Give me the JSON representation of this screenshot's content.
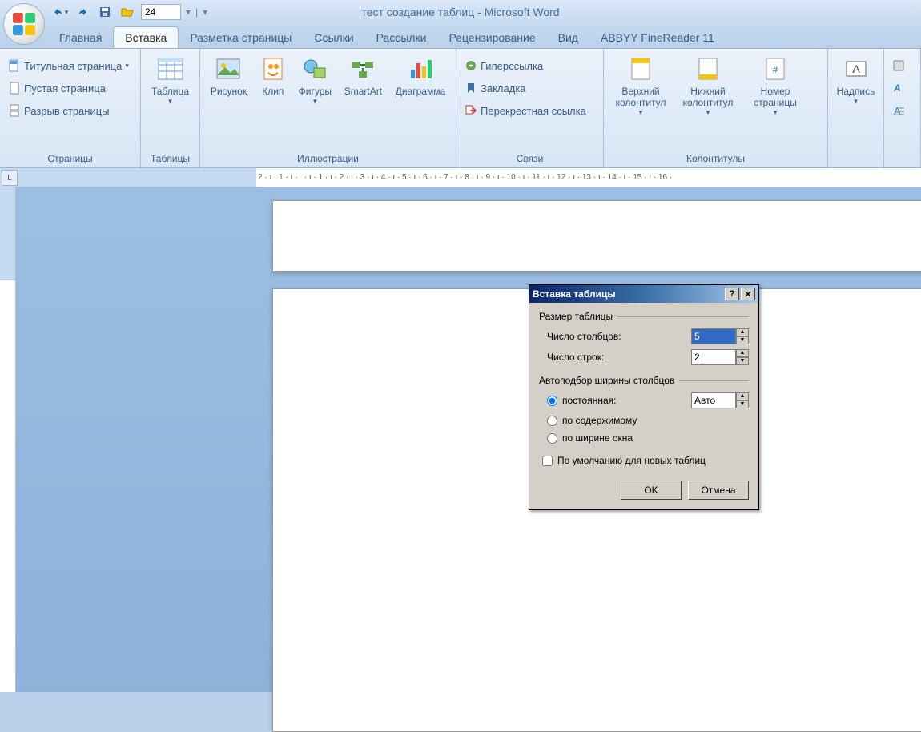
{
  "window": {
    "title": "тест создание таблиц - Microsoft Word"
  },
  "qat": {
    "font_size": "24"
  },
  "tabs": {
    "home": "Главная",
    "insert": "Вставка",
    "layout": "Разметка страницы",
    "refs": "Ссылки",
    "mail": "Рассылки",
    "review": "Рецензирование",
    "view": "Вид",
    "abbyy": "ABBYY FineReader 11"
  },
  "ribbon": {
    "pages": {
      "label": "Страницы",
      "cover": "Титульная страница",
      "blank": "Пустая страница",
      "break": "Разрыв страницы"
    },
    "tables": {
      "label": "Таблицы",
      "table": "Таблица"
    },
    "illus": {
      "label": "Иллюстрации",
      "picture": "Рисунок",
      "clip": "Клип",
      "shapes": "Фигуры",
      "smartart": "SmartArt",
      "chart": "Диаграмма"
    },
    "links": {
      "label": "Связи",
      "hyperlink": "Гиперссылка",
      "bookmark": "Закладка",
      "crossref": "Перекрестная ссылка"
    },
    "headers": {
      "label": "Колонтитулы",
      "header": "Верхний колонтитул",
      "footer": "Нижний колонтитул",
      "pagenum": "Номер страницы"
    },
    "text": {
      "caption": "Надпись"
    }
  },
  "ruler": {
    "horizontal": "2 · ı · 1 · ı ·   · ı · 1 · ı · 2 · ı · 3 · ı · 4 · ı · 5 · ı · 6 · ı · 7 · ı · 8 · ı · 9 · ı · 10 · ı · 11 · ı · 12 · ı · 13 · ı · 14 · ı · 15 · ı · 16 ·",
    "corner": "L"
  },
  "dialog": {
    "title": "Вставка таблицы",
    "section1": "Размер таблицы",
    "cols_label": "Число столбцов:",
    "cols_value": "5",
    "rows_label": "Число строк:",
    "rows_value": "2",
    "section2": "Автоподбор ширины столбцов",
    "fixed": "постоянная:",
    "fixed_value": "Авто",
    "fit_content": "по содержимому",
    "fit_window": "по ширине окна",
    "remember": "По умолчанию для новых таблиц",
    "ok": "OK",
    "cancel": "Отмена"
  }
}
